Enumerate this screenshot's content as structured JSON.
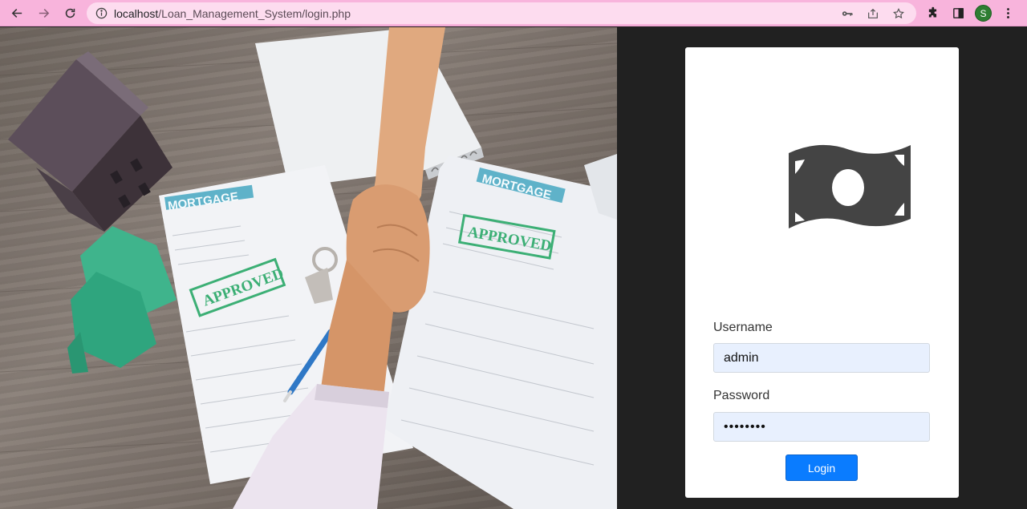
{
  "browser": {
    "url_host": "localhost",
    "url_path": "/Loan_Management_System/login.php",
    "profile_initial": "S",
    "icons": [
      "back-icon",
      "forward-icon",
      "reload-icon",
      "site-info-icon",
      "password-key-icon",
      "share-icon",
      "bookmark-star-icon",
      "extensions-icon",
      "side-panel-icon",
      "menu-kebab-icon"
    ],
    "accent_color": "#f8b4dc"
  },
  "hero_photo": {
    "stamp_text_1": "APPROVED",
    "stamp_text_2": "APPROVED",
    "doc_header_1": "MORTGAGE",
    "doc_header_2": "MORTGAGE"
  },
  "login": {
    "logo_icon": "money-bill-icon",
    "username_label": "Username",
    "username_value": "admin",
    "password_label": "Password",
    "password_value": "••••••••",
    "login_button": "Login",
    "button_color": "#0a7cff"
  }
}
